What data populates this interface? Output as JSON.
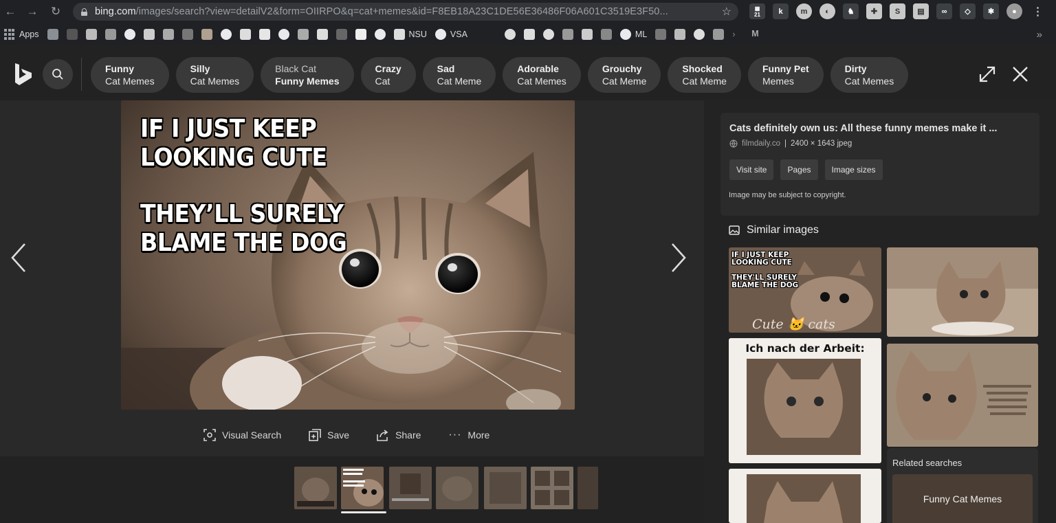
{
  "browser": {
    "url_host": "bing.com",
    "url_path": "/images/search?view=detailV2&form=OIIRPO&q=cat+memes&id=F8EB18A23C1DE56E36486F06A601C3519E3F50...",
    "bookmarks": [
      {
        "label": "Apps",
        "icon": "apps-grid-icon"
      },
      {
        "label": "NSU",
        "icon": "windows-icon"
      },
      {
        "label": "VSA",
        "icon": "globe-icon"
      },
      {
        "label": "ML",
        "icon": "globe-icon"
      }
    ],
    "extension_badge": "21",
    "extension_k": "k"
  },
  "bing": {
    "chips": [
      {
        "line1": "Funny",
        "line2": "Cat Memes"
      },
      {
        "line1": "Silly",
        "line2": "Cat Memes"
      },
      {
        "line1": "Black Cat",
        "line2": "Funny Memes"
      },
      {
        "line1": "Crazy",
        "line2": "Cat"
      },
      {
        "line1": "Sad",
        "line2": "Cat Meme"
      },
      {
        "line1": "Adorable",
        "line2": "Cat Memes"
      },
      {
        "line1": "Grouchy",
        "line2": "Cat Meme"
      },
      {
        "line1": "Shocked",
        "line2": "Cat Meme"
      },
      {
        "line1": "Funny Pet",
        "line2": "Memes"
      },
      {
        "line1": "Dirty",
        "line2": "Cat Memes"
      }
    ],
    "meme": {
      "line1": "IF I JUST KEEP",
      "line2": "LOOKING CUTE",
      "line3": "THEY’LL SURELY",
      "line4": "BLAME THE DOG"
    },
    "actions": {
      "visual_search": "Visual Search",
      "save": "Save",
      "share": "Share",
      "more": "More"
    },
    "info": {
      "title": "Cats definitely own us: All these funny memes make it ...",
      "site": "filmdaily.co",
      "separator": "|",
      "dims": "2400 × 1643 jpeg",
      "visit_site": "Visit site",
      "pages": "Pages",
      "image_sizes": "Image sizes",
      "copyright": "Image may be subject to copyright."
    },
    "similar_images_label": "Similar images",
    "similar": {
      "tile1_line1": "IF I JUST KEEP",
      "tile1_line2": "LOOKING CUTE",
      "tile1_line3": "THEY'LL SURELY",
      "tile1_line4": "BLAME THE DOG",
      "tile1_caption": "Cute 🐱 cats",
      "tile3_caption": "Ich nach der Arbeit:"
    },
    "related_searches_label": "Related searches",
    "related_first": "Funny Cat Memes"
  },
  "colors": {
    "sepia_dark": "#3d2f25",
    "sepia_mid": "#7a6250",
    "sepia_light": "#b9a08a",
    "panel_bg": "#242323"
  }
}
